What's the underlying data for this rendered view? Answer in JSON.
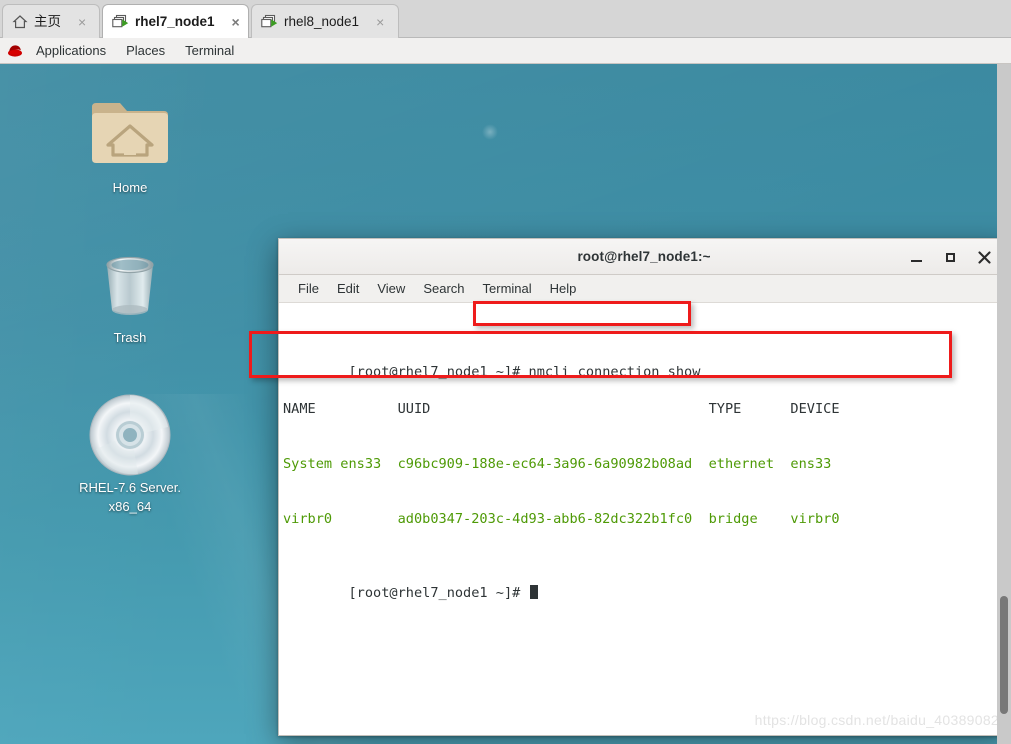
{
  "browser": {
    "tabs": [
      {
        "label": "主页",
        "icon": "home-icon",
        "active": false,
        "close_label": "×"
      },
      {
        "label": "rhel7_node1",
        "icon": "virtual-machine-icon",
        "active": true,
        "close_label": "×"
      },
      {
        "label": "rhel8_node1",
        "icon": "virtual-machine-icon",
        "active": false,
        "close_label": "×"
      }
    ]
  },
  "gnome_panel": {
    "logo": "redhat-logo-icon",
    "items": [
      {
        "label": "Applications"
      },
      {
        "label": "Places"
      },
      {
        "label": "Terminal"
      }
    ]
  },
  "desktop": {
    "background_color": "#3f8fa6",
    "icons": [
      {
        "name": "home-folder-icon",
        "label": "Home"
      },
      {
        "name": "trash-icon",
        "label": "Trash"
      },
      {
        "name": "cdrom-icon",
        "label_line1": "RHEL-7.6 Server.",
        "label_line2": "x86_64"
      }
    ]
  },
  "terminal": {
    "title": "root@rhel7_node1:~",
    "window_buttons": {
      "minimize": "minimize-button",
      "maximize": "maximize-button",
      "close": "close-button"
    },
    "menu": [
      {
        "label": "File"
      },
      {
        "label": "Edit"
      },
      {
        "label": "View"
      },
      {
        "label": "Search"
      },
      {
        "label": "Terminal"
      },
      {
        "label": "Help"
      }
    ],
    "lines": {
      "prompt1": "[root@rhel7_node1 ~]# ",
      "command1": "nmcli connection show",
      "header": "NAME          UUID                                  TYPE      DEVICE",
      "row1": "System ens33  c96bc909-188e-ec64-3a96-6a90982b08ad  ethernet  ens33 ",
      "row2": "virbr0        ad0b0347-203c-4d93-abb6-82dc322b1fc0  bridge    virbr0",
      "prompt2": "[root@rhel7_node1 ~]# "
    },
    "text_colors": {
      "default": "#2e3436",
      "green": "#4e9a06"
    }
  },
  "annotations": {
    "highlight_color": "#ee1b1b",
    "boxes": [
      {
        "name": "command-highlight",
        "target": "nmcli connection show"
      },
      {
        "name": "output-rows-highlight",
        "target": "connection table rows"
      }
    ]
  },
  "watermark": {
    "text": "https://blog.csdn.net/baidu_40389082"
  }
}
